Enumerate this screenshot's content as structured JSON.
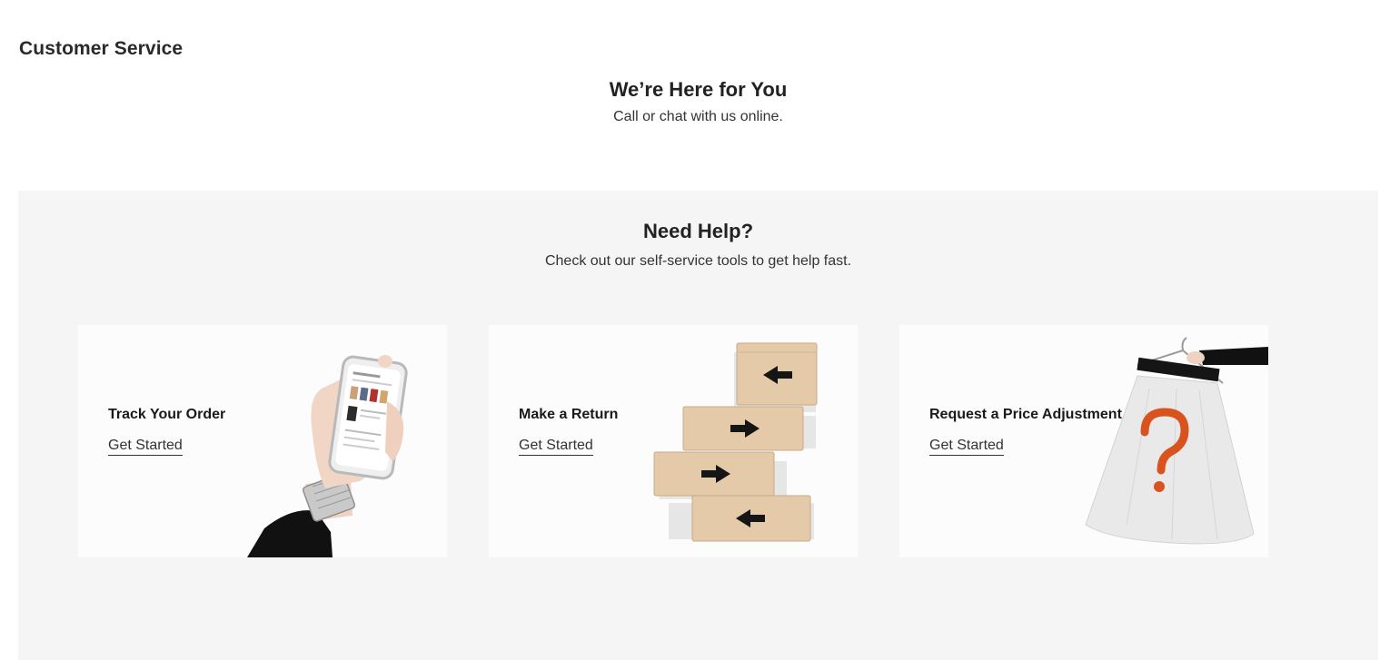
{
  "page": {
    "title": "Customer Service"
  },
  "hero": {
    "heading": "We’re Here for You",
    "subtext": "Call or chat with us online."
  },
  "help": {
    "heading": "Need Help?",
    "subtext": "Check out our self-service tools to get help fast.",
    "cards": [
      {
        "title": "Track Your Order",
        "link": "Get Started",
        "image": "phone-in-hand-illustration"
      },
      {
        "title": "Make a Return",
        "link": "Get Started",
        "image": "stacked-boxes-illustration"
      },
      {
        "title": "Request a Price Adjustment",
        "link": "Get Started",
        "image": "skirt-question-mark-illustration"
      }
    ]
  },
  "colors": {
    "panel_bg": "#f5f5f5",
    "card_bg": "#fcfcfc",
    "text": "#1f1f1f",
    "box": "#e3c9a8",
    "arrow": "#1a1a1a",
    "question_mark": "#d9531e"
  }
}
